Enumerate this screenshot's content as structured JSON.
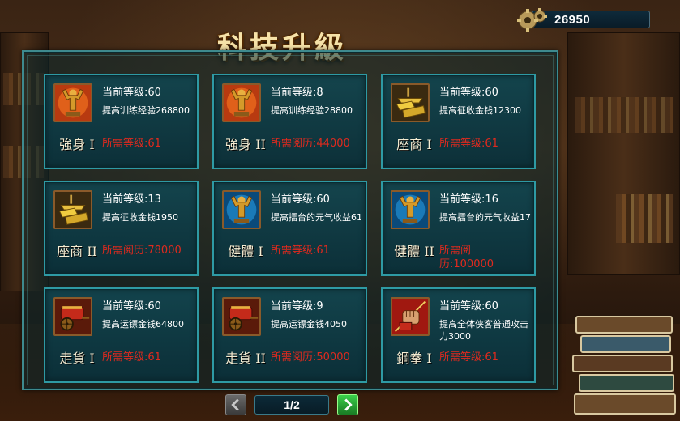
{
  "header": {
    "title": "科技升級",
    "gold_amount": "26950"
  },
  "cards": [
    {
      "name": "強身 I",
      "level": "当前等级:60",
      "desc": "提高训练经验268800",
      "req": "所需等级:61",
      "icon": "muscle-statue-red-icon"
    },
    {
      "name": "強身 II",
      "level": "当前等级:8",
      "desc": "提高训练经验28800",
      "req": "所需阅历:44000",
      "icon": "muscle-statue-red-icon"
    },
    {
      "name": "座商 I",
      "level": "当前等级:60",
      "desc": "提高征收金钱12300",
      "req": "所需等级:61",
      "icon": "gold-ingot-stack-icon"
    },
    {
      "name": "座商 II",
      "level": "当前等级:13",
      "desc": "提高征收金钱1950",
      "req": "所需阅历:78000",
      "icon": "gold-ingot-stack-icon"
    },
    {
      "name": "健體 I",
      "level": "当前等级:60",
      "desc": "提高擂台的元气收益61",
      "req": "所需等级:61",
      "icon": "muscle-statue-blue-icon"
    },
    {
      "name": "健體 II",
      "level": "当前等级:16",
      "desc": "提高擂台的元气收益17",
      "req": "所需阅历:100000",
      "icon": "muscle-statue-blue-icon"
    },
    {
      "name": "走貨 I",
      "level": "当前等级:60",
      "desc": "提高运镖金钱64800",
      "req": "所需等级:61",
      "icon": "cart-wheel-icon"
    },
    {
      "name": "走貨 II",
      "level": "当前等级:9",
      "desc": "提高运镖金钱4050",
      "req": "所需阅历:50000",
      "icon": "cart-wheel-icon"
    },
    {
      "name": "鋼拳 I",
      "level": "当前等级:60",
      "desc": "提高全体侠客普通攻击力3000",
      "req": "所需等级:61",
      "icon": "iron-fist-icon"
    }
  ],
  "pagination": {
    "label": "1/2"
  },
  "colors": {
    "card_border": "#2e9aa4",
    "requirement_text": "#e02a1e",
    "next_button": "#3ad04a"
  }
}
